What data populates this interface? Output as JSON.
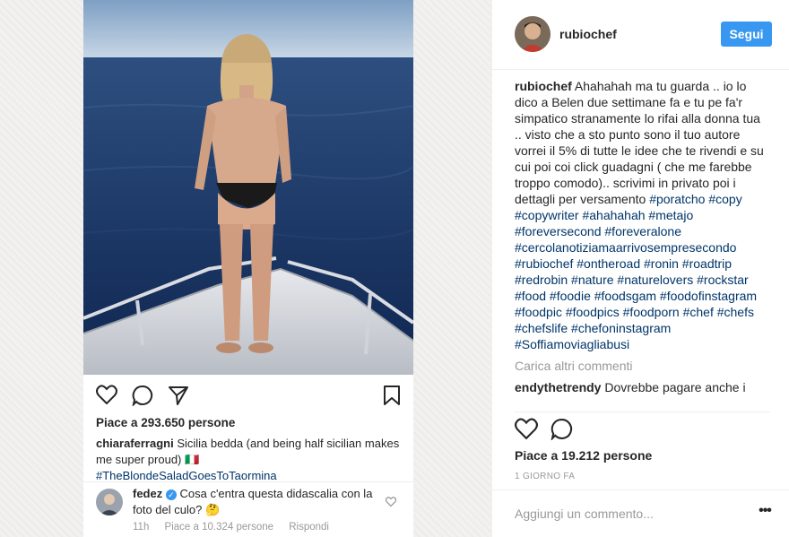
{
  "embedded_post": {
    "likes_text": "Piace a 293.650 persone",
    "caption": {
      "user": "chiaraferragni",
      "text": "Sicilia bedda (and being half sicilian makes me super proud) 🇮🇹",
      "hashtag": "#TheBlondeSaladGoesToTaormina"
    },
    "reply": {
      "user": "fedez",
      "text": "Cosa c'entra questa didascalia con la foto del culo? 🤔",
      "time": "11h",
      "likes": "Piace a 10.324 persone",
      "reply_label": "Rispondi"
    }
  },
  "post": {
    "username": "rubiochef",
    "follow_label": "Segui",
    "caption_user": "rubiochef",
    "caption_text": "Ahahahah ma tu guarda .. io lo dico a Belen due settimane fa e tu pe fa'r simpatico stranamente lo rifai alla donna tua .. visto che a sto punto sono il tuo autore vorrei il 5% di tutte le idee che te rivendi e su cui poi coi click guadagni ( che me farebbe troppo comodo).. scrivimi in privato poi i dettagli per versamento",
    "hashtags": "#poratcho #copy #copywriter #ahahahah #metajo #foreversecond #foreveralone #cercolanotiziamaarrivosempresecondo #rubiochef #ontheroad #ronin #roadtrip #redrobin #nature #naturelovers #rockstar #food #foodie #foodsgam #foodofinstagram #foodpic #foodpics #foodporn #chef #chefs #chefslife #chefoninstagram #Soffiamoviagliabusi",
    "load_more_label": "Carica altri commenti",
    "next_comment_user": "endythetrendy",
    "next_comment_text": "Dovrebbe pagare anche i",
    "likes_text": "Piace a 19.212 persone",
    "timestamp": "1 GIORNO FA",
    "add_comment_placeholder": "Aggiungi un commento...",
    "more_label": "•••"
  },
  "colors": {
    "link": "#003569",
    "accent": "#3897f0",
    "muted": "#999999"
  }
}
